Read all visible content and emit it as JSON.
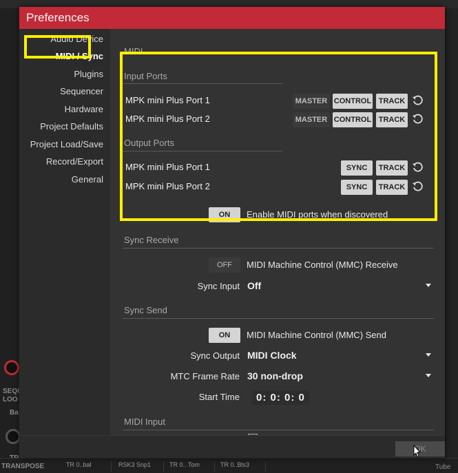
{
  "dialog": {
    "title": "Preferences",
    "ok_label": "OK"
  },
  "sidebar": {
    "items": [
      {
        "label": "Audio Device"
      },
      {
        "label": "MIDI / Sync"
      },
      {
        "label": "Plugins"
      },
      {
        "label": "Sequencer"
      },
      {
        "label": "Hardware"
      },
      {
        "label": "Project Defaults"
      },
      {
        "label": "Project Load/Save"
      },
      {
        "label": "Record/Export"
      },
      {
        "label": "General"
      }
    ],
    "active": "MIDI / Sync"
  },
  "midi": {
    "heading": "MIDI",
    "input_ports_heading": "Input Ports",
    "output_ports_heading": "Output Ports",
    "input_ports": [
      {
        "name": "MPK mini Plus Port 1",
        "master": "MASTER",
        "control": "CONTROL",
        "track": "TRACK"
      },
      {
        "name": "MPK mini Plus Port 2",
        "master": "MASTER",
        "control": "CONTROL",
        "track": "TRACK"
      }
    ],
    "output_ports": [
      {
        "name": "MPK mini Plus Port 1",
        "sync": "SYNC",
        "track": "TRACK"
      },
      {
        "name": "MPK mini Plus Port 2",
        "sync": "SYNC",
        "track": "TRACK"
      }
    ],
    "enable_toggle": "ON",
    "enable_label": "Enable MIDI ports when discovered"
  },
  "sync_receive": {
    "heading": "Sync Receive",
    "mmc_toggle": "OFF",
    "mmc_label": "MIDI Machine Control (MMC) Receive",
    "sync_input_label": "Sync Input",
    "sync_input_value": "Off"
  },
  "sync_send": {
    "heading": "Sync Send",
    "mmc_toggle": "ON",
    "mmc_label": "MIDI Machine Control (MMC) Send",
    "sync_output_label": "Sync Output",
    "sync_output_value": "MIDI Clock",
    "mtc_label": "MTC Frame Rate",
    "mtc_value": "30 non-drop",
    "start_time_label": "Start Time",
    "start_time_value": "0:  0:  0:  0"
  },
  "midi_input": {
    "heading": "MIDI Input"
  },
  "background": {
    "left_labels": [
      "SEQU",
      "LOO",
      "Ba",
      "TR",
      "TRANSPOSE"
    ],
    "pads": [
      "TR 0..bal",
      "RSK3 Snp1",
      "TR 0.. Tom",
      "TR 0..Bls3"
    ],
    "right_label": "Tube"
  },
  "colors": {
    "titlebar": "#c22a38",
    "highlight": "#ffef00",
    "dialog_bg": "#2b2b2b",
    "content_bg": "#333333"
  }
}
